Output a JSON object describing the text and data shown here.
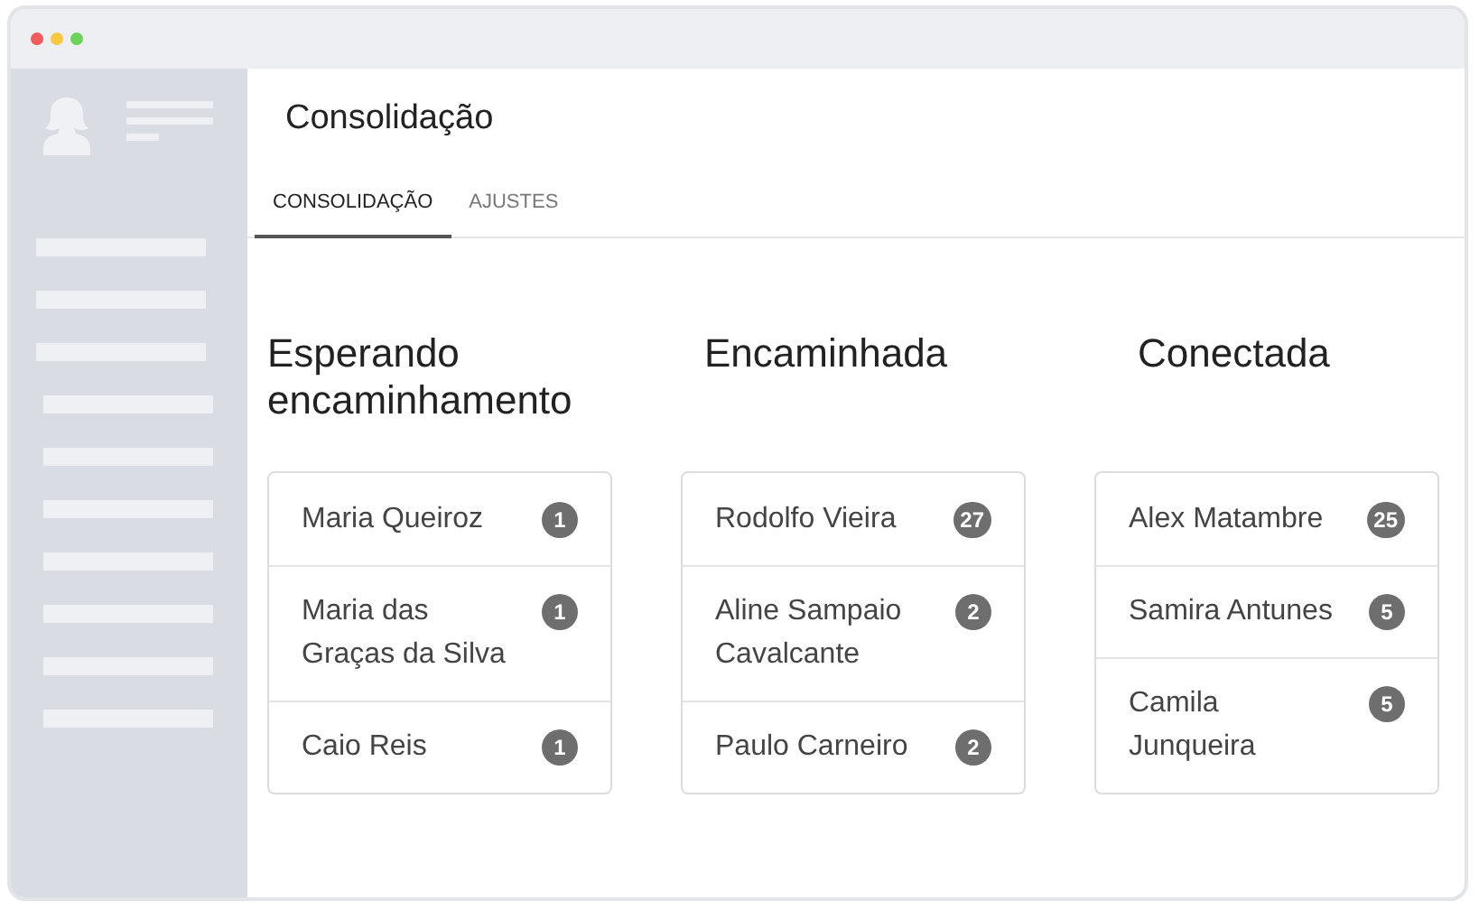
{
  "window": {
    "title": "Consolidação"
  },
  "tabs": [
    {
      "label": "CONSOLIDAÇÃO",
      "selected": true
    },
    {
      "label": "AJUSTES",
      "selected": false
    }
  ],
  "columns": [
    {
      "title": "Esperando encaminhamento",
      "items": [
        {
          "name": "Maria Queiroz",
          "count": "1"
        },
        {
          "name": "Maria das Graças da Silva",
          "count": "1"
        },
        {
          "name": "Caio Reis",
          "count": "1"
        }
      ]
    },
    {
      "title": "Encaminhada",
      "items": [
        {
          "name": "Rodolfo Vieira",
          "count": "27"
        },
        {
          "name": "Aline Sampaio Cavalcante",
          "count": "2"
        },
        {
          "name": "Paulo Carneiro",
          "count": "2"
        }
      ]
    },
    {
      "title": "Conectada",
      "items": [
        {
          "name": "Alex Matambre",
          "count": "25"
        },
        {
          "name": "Samira Antunes",
          "count": "5"
        },
        {
          "name": "Camila Junqueira",
          "count": "5"
        }
      ]
    }
  ]
}
